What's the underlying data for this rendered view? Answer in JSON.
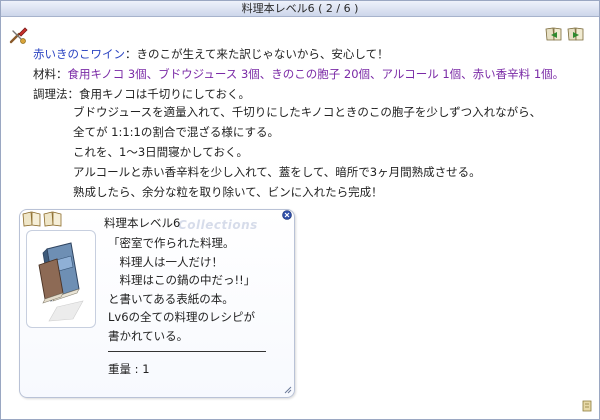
{
  "window": {
    "title": "料理本レベル6 ( 2 / 6 )"
  },
  "icons": {
    "tool": "cooking-tool-icon",
    "prev_page": "book-prev-icon",
    "next_page": "book-next-icon",
    "close": "close-icon",
    "book_open": "open-book-icon",
    "resize": "resize-grip-icon",
    "item_image": "cookbook-item-icon"
  },
  "recipe": {
    "name": "赤いきのこワイン",
    "name_sep": "：",
    "comment": "きのこが生えて来た訳じゃないから、安心して！",
    "materials_label": "材料：",
    "materials": "食用キノコ 3個、ブドウジュース 3個、きのこの胞子 20個、アルコール 1個、赤い香辛料 1個。",
    "method_label": "調理法：",
    "method_first": "食用キノコは千切りにしておく。",
    "steps": [
      "ブドウジュースを適量入れて、千切りにしたキノコときのこの胞子を少しずつ入れながら、",
      "全てが 1:1:1の割合で混ざる様にする。",
      "これを、1～3日間寝かしておく。",
      "アルコールと赤い香辛料を少し入れて、蓋をして、暗所で3ヶ月間熟成させる。",
      "熟成したら、余分な粒を取り除いて、ビンに入れたら完成！"
    ]
  },
  "item_info": {
    "title": "料理本レベル6",
    "watermark": "Collections",
    "description_lines": [
      "「密室で作られた料理。",
      "　料理人は一人だけ！",
      "　料理はこの鍋の中だっ!!」",
      "と書いてある表紙の本。",
      "Lv6の全ての料理のレシピが",
      "書かれている。"
    ],
    "weight_label": "重量 : ",
    "weight_value": "1"
  },
  "colors": {
    "recipe_name": "#2c45c2",
    "materials": "#7a2aa6",
    "title_bar_top": "#eef2fb",
    "title_bar_bottom": "#cdd6ea"
  }
}
